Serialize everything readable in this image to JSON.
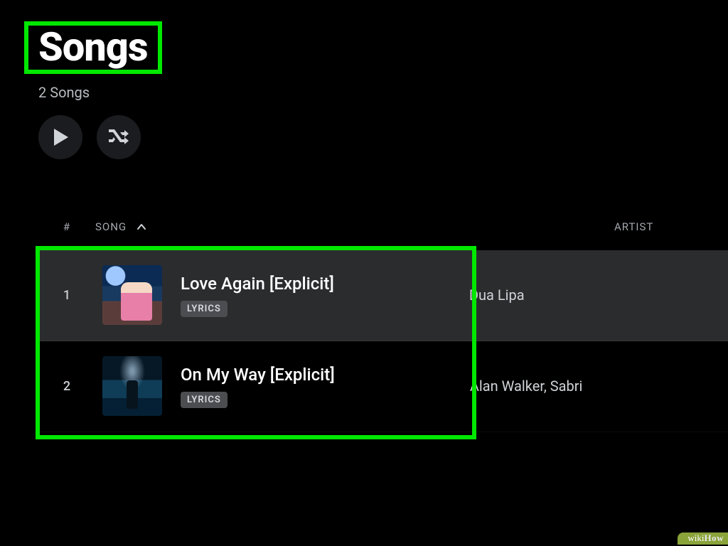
{
  "header": {
    "title": "Songs",
    "subtitle": "2 Songs"
  },
  "controls": {
    "play_label": "Play",
    "shuffle_label": "Shuffle"
  },
  "columns": {
    "index": "#",
    "song": "SONG",
    "artist": "ARTIST",
    "sort_indicator": "˄"
  },
  "badges": {
    "lyrics": "LYRICS"
  },
  "songs": [
    {
      "index": "1",
      "title": "Love Again [Explicit]",
      "artist": "Dua Lipa",
      "has_lyrics": true,
      "selected": true
    },
    {
      "index": "2",
      "title": "On My Way [Explicit]",
      "artist": "Alan Walker, Sabri",
      "has_lyrics": true,
      "selected": false
    }
  ],
  "annotation": {
    "highlight_color": "#00e800"
  },
  "watermark": {
    "part1": "wiki",
    "part2": "How"
  }
}
